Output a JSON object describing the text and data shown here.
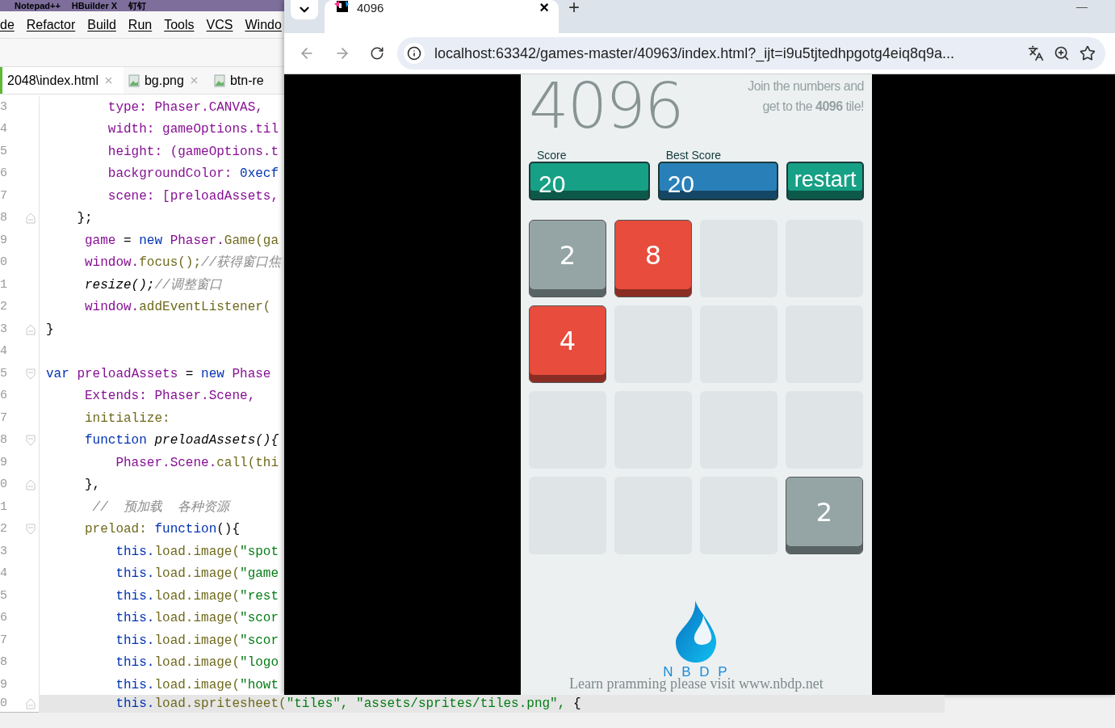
{
  "taskbar": [
    "Notepad++",
    "HBuilder X",
    "钉钉"
  ],
  "ide": {
    "menu": [
      "de",
      "Refactor",
      "Build",
      "Run",
      "Tools",
      "VCS",
      "Windo"
    ],
    "tabs": [
      {
        "label": "2048\\index.html",
        "selected": true,
        "kind": "html"
      },
      {
        "label": "bg.png",
        "selected": false,
        "kind": "image"
      },
      {
        "label": "btn-re",
        "selected": false,
        "kind": "image"
      }
    ],
    "lines": [
      {
        "number": "3",
        "kind": "plain",
        "tokens": [
          {
            "text": "        type: Phaser.CANVAS,",
            "kind": "field"
          }
        ]
      },
      {
        "number": "4",
        "kind": "plain",
        "tokens": [
          {
            "text": "        width: gameOptions.til",
            "kind": "field"
          }
        ]
      },
      {
        "number": "5",
        "kind": "plain",
        "tokens": [
          {
            "text": "        height: (gameOptions.t",
            "kind": "field"
          }
        ]
      },
      {
        "number": "6",
        "kind": "plain",
        "tokens": [
          {
            "text": "        backgroundColor: ",
            "kind": "field"
          },
          {
            "text": "0xecf",
            "kind": "keyword"
          }
        ]
      },
      {
        "number": "7",
        "kind": "plain",
        "tokens": [
          {
            "text": "        scene: [preloadAssets,",
            "kind": "field"
          }
        ]
      },
      {
        "number": "8",
        "kind": "fold-end",
        "tokens": [
          {
            "text": "    };",
            "kind": "plain"
          }
        ]
      },
      {
        "number": "9",
        "kind": "plain",
        "tokens": [
          {
            "text": "     game",
            "kind": "field"
          },
          {
            "text": " = ",
            "kind": "plain"
          },
          {
            "text": "new",
            "kind": "keyword"
          },
          {
            "text": " Phaser.",
            "kind": "field"
          },
          {
            "text": "Game(ga",
            "kind": "method"
          }
        ]
      },
      {
        "number": "0",
        "kind": "plain",
        "tokens": [
          {
            "text": "     window.",
            "kind": "field"
          },
          {
            "text": "focus();",
            "kind": "method"
          },
          {
            "text": "//获得窗口焦",
            "kind": "comment"
          }
        ]
      },
      {
        "number": "1",
        "kind": "plain",
        "tokens": [
          {
            "text": "     resize();",
            "kind": "call"
          },
          {
            "text": "//调整窗口",
            "kind": "comment"
          }
        ]
      },
      {
        "number": "2",
        "kind": "plain",
        "tokens": [
          {
            "text": "     window.",
            "kind": "field"
          },
          {
            "text": "addEventListener(",
            "kind": "method"
          }
        ]
      },
      {
        "number": "3",
        "kind": "fold-end",
        "tokens": [
          {
            "text": "}",
            "kind": "plain"
          }
        ]
      },
      {
        "number": "4",
        "kind": "plain"
      },
      {
        "number": "5",
        "kind": "fold-start",
        "tokens": [
          {
            "text": "var",
            "kind": "keyword"
          },
          {
            "text": " preloadAssets ",
            "kind": "field"
          },
          {
            "text": "= ",
            "kind": "plain"
          },
          {
            "text": "new",
            "kind": "keyword"
          },
          {
            "text": " Phase",
            "kind": "field"
          }
        ]
      },
      {
        "number": "6",
        "kind": "plain",
        "tokens": [
          {
            "text": "     Extends: Phaser.Scene,",
            "kind": "field"
          }
        ]
      },
      {
        "number": "7",
        "kind": "plain",
        "tokens": [
          {
            "text": "     initialize:",
            "kind": "method"
          }
        ]
      },
      {
        "number": "8",
        "kind": "fold-start",
        "tokens": [
          {
            "text": "     function",
            "kind": "keyword"
          },
          {
            "text": " preloadAssets(){",
            "kind": "call"
          }
        ]
      },
      {
        "number": "9",
        "kind": "plain",
        "tokens": [
          {
            "text": "         Phaser.Scene.",
            "kind": "field"
          },
          {
            "text": "call(thi",
            "kind": "method"
          }
        ]
      },
      {
        "number": "0",
        "kind": "fold-end",
        "tokens": [
          {
            "text": "     },",
            "kind": "plain"
          }
        ]
      },
      {
        "number": "1",
        "kind": "plain",
        "tokens": [
          {
            "text": "      //  预加载  各种资源",
            "kind": "comment"
          }
        ]
      },
      {
        "number": "2",
        "kind": "fold-start",
        "tokens": [
          {
            "text": "     preload: ",
            "kind": "method"
          },
          {
            "text": "function",
            "kind": "keyword"
          },
          {
            "text": "(){",
            "kind": "plain"
          }
        ]
      },
      {
        "number": "3",
        "kind": "plain",
        "tokens": [
          {
            "text": "         this.",
            "kind": "keyword"
          },
          {
            "text": "load.image(",
            "kind": "method"
          },
          {
            "text": "\"spot",
            "kind": "string"
          }
        ]
      },
      {
        "number": "4",
        "kind": "plain",
        "tokens": [
          {
            "text": "         this.",
            "kind": "keyword"
          },
          {
            "text": "load.image(",
            "kind": "method"
          },
          {
            "text": "\"game",
            "kind": "string"
          }
        ]
      },
      {
        "number": "5",
        "kind": "plain",
        "tokens": [
          {
            "text": "         this.",
            "kind": "keyword"
          },
          {
            "text": "load.image(",
            "kind": "method"
          },
          {
            "text": "\"rest",
            "kind": "string"
          }
        ]
      },
      {
        "number": "6",
        "kind": "plain",
        "tokens": [
          {
            "text": "         this.",
            "kind": "keyword"
          },
          {
            "text": "load.image(",
            "kind": "method"
          },
          {
            "text": "\"scor",
            "kind": "string"
          }
        ]
      },
      {
        "number": "7",
        "kind": "plain",
        "tokens": [
          {
            "text": "         this.",
            "kind": "keyword"
          },
          {
            "text": "load.image(",
            "kind": "method"
          },
          {
            "text": "\"scor",
            "kind": "string"
          }
        ]
      },
      {
        "number": "8",
        "kind": "plain",
        "tokens": [
          {
            "text": "         this.",
            "kind": "keyword"
          },
          {
            "text": "load.image(",
            "kind": "method"
          },
          {
            "text": "\"logo",
            "kind": "string"
          }
        ]
      },
      {
        "number": "9",
        "kind": "plain",
        "tokens": [
          {
            "text": "         this.",
            "kind": "keyword"
          },
          {
            "text": "load.image(",
            "kind": "method"
          },
          {
            "text": "\"howt",
            "kind": "string"
          }
        ]
      }
    ],
    "last_line": {
      "number": "0",
      "kind": "fold-end",
      "tokens": [
        {
          "text": "         this.",
          "kind": "keyword"
        },
        {
          "text": "load.spritesheet(",
          "kind": "method"
        },
        {
          "text": "\"tiles\", \"assets/sprites/tiles.png\",",
          "kind": "string"
        },
        {
          "text": " {",
          "kind": "plain"
        }
      ]
    }
  },
  "browser": {
    "tab": {
      "title": "4096",
      "close": "×"
    },
    "new_tab": "+",
    "minimize": "—",
    "url": "localhost:63342/games-master/40963/index.html?_ijt=i9u5tjtedhpgotg4eiq8q9a..."
  },
  "game": {
    "title": "4096",
    "tagline": [
      "Join the numbers and",
      "get to the **4096** tile!"
    ],
    "scores": [
      {
        "label": "Score",
        "value": "20",
        "color": "#16a085"
      },
      {
        "label": "Best Score",
        "value": "20",
        "color": "#2980b9"
      }
    ],
    "restart": "restart",
    "grid": [
      [
        {
          "kind": "tile",
          "value": "2",
          "color": "#95a5a6"
        },
        {
          "kind": "tile",
          "value": "8",
          "color": "#e74c3c"
        },
        {
          "kind": "empty"
        },
        {
          "kind": "empty"
        }
      ],
      [
        {
          "kind": "tile",
          "value": "4",
          "color": "#e74c3c"
        },
        {
          "kind": "empty"
        },
        {
          "kind": "empty"
        },
        {
          "kind": "empty"
        }
      ],
      [
        {
          "kind": "empty"
        },
        {
          "kind": "empty"
        },
        {
          "kind": "empty"
        },
        {
          "kind": "empty"
        }
      ],
      [
        {
          "kind": "empty"
        },
        {
          "kind": "empty"
        },
        {
          "kind": "empty"
        },
        {
          "kind": "tile",
          "value": "2",
          "color": "#95a5a6"
        }
      ]
    ],
    "brand": "N B D P",
    "footer": "Learn pramming please visit www.nbdp.net"
  }
}
